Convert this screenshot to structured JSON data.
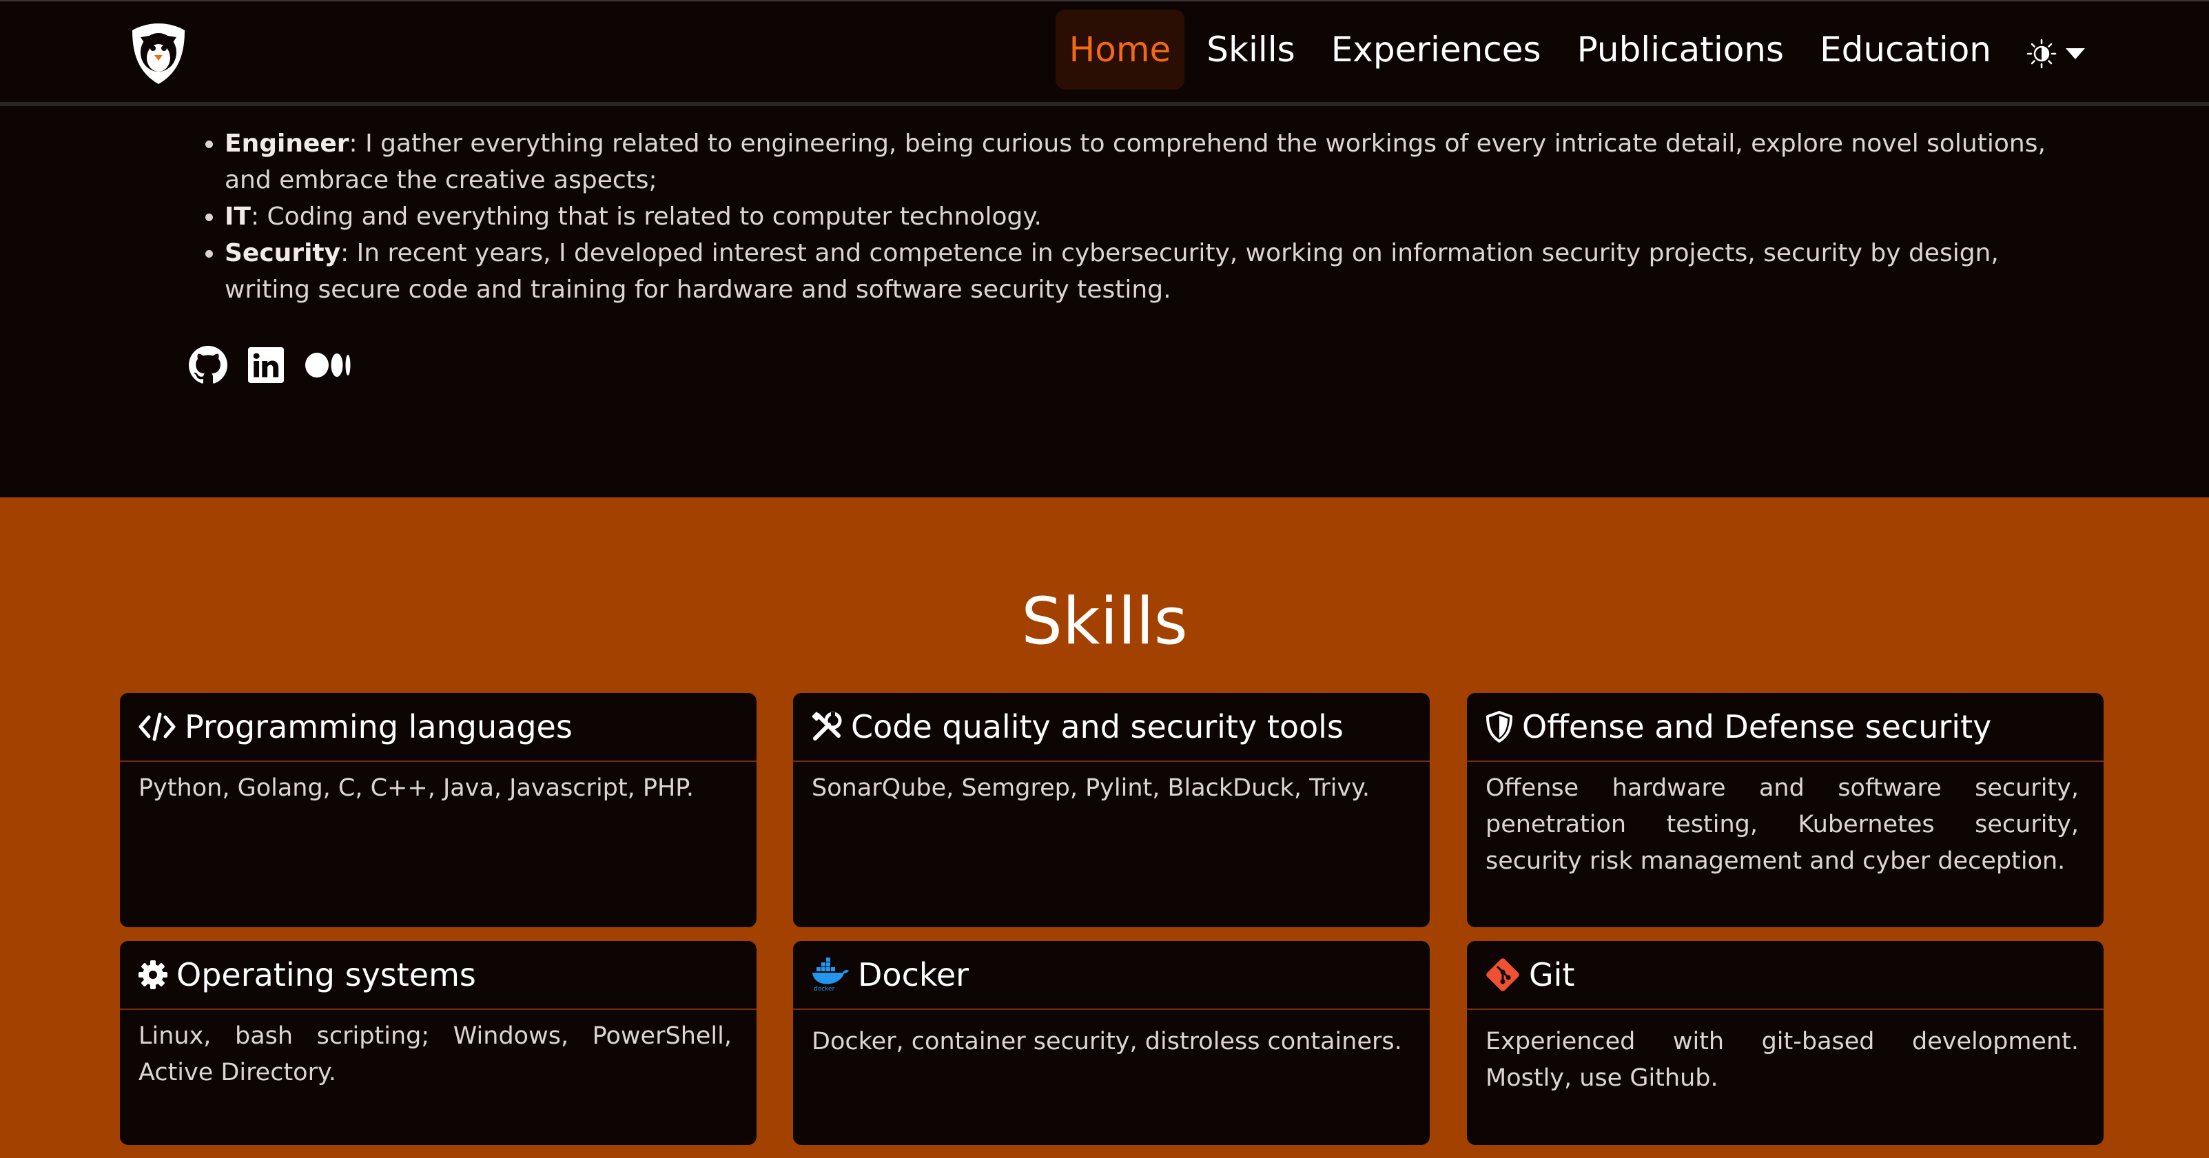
{
  "nav": {
    "links": [
      "Home",
      "Skills",
      "Experiences",
      "Publications",
      "Education"
    ],
    "active": "Home",
    "logo_icon": "penguin-shield-logo",
    "theme_icon": "half-sun-icon"
  },
  "intro": {
    "items": [
      {
        "term": "Engineer",
        "text": ": I gather everything related to engineering, being curious to comprehend the workings of every intricate detail, explore novel solutions, and embrace the creative aspects;"
      },
      {
        "term": "IT",
        "text": ": Coding and everything that is related to computer technology."
      },
      {
        "term": "Security",
        "text": ": In recent years, I developed interest and competence in cybersecurity, working on information security projects, security by design, writing secure code and training for hardware and software security testing."
      }
    ],
    "social_icons": [
      "github-icon",
      "linkedin-icon",
      "medium-icon"
    ]
  },
  "skills": {
    "title": "Skills",
    "background": "#a34200",
    "cards": [
      {
        "title": "Programming languages",
        "icon": "code-icon",
        "body": "Python, Golang, C, C++, Java, Javascript, PHP."
      },
      {
        "title": "Code quality and security tools",
        "icon": "tools-icon",
        "body": "SonarQube, Semgrep, Pylint, BlackDuck, Trivy."
      },
      {
        "title": "Offense and Defense security",
        "icon": "shield-icon",
        "body": "Offense hardware and software security, penetration testing, Kubernetes security, security risk management and cyber deception."
      },
      {
        "title": "Operating systems",
        "icon": "gear-icon",
        "body": "Linux, bash scripting; Windows, PowerShell, Active Directory."
      },
      {
        "title": "Docker",
        "icon": "docker-icon",
        "icon_label": "docker",
        "body": "Docker, container security, distroless containers."
      },
      {
        "title": "Git",
        "icon": "git-icon",
        "body": "Experienced with git-based development. Mostly, use Github."
      }
    ]
  },
  "colors": {
    "accent": "#f26a16",
    "page_bg": "#0c0504",
    "skills_bg": "#a34200",
    "card_divider": "#7a2c12"
  }
}
